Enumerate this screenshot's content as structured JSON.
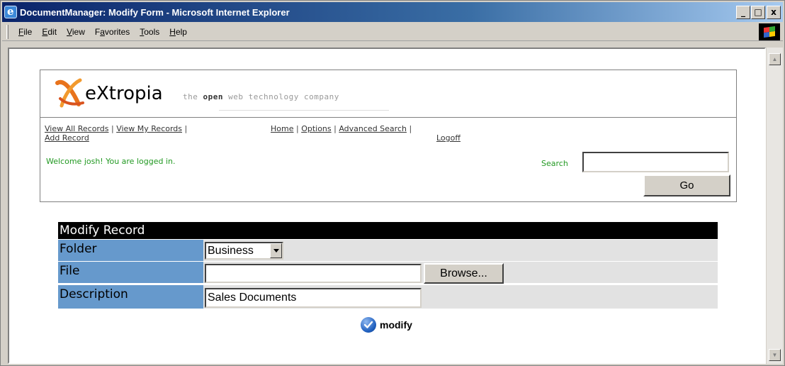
{
  "window": {
    "title": "DocumentManager: Modify Form - Microsoft Internet Explorer",
    "controls": [
      "_",
      "□",
      "x"
    ]
  },
  "menu": {
    "items": [
      {
        "label": "File",
        "underline_index": 0
      },
      {
        "label": "Edit",
        "underline_index": 0
      },
      {
        "label": "View",
        "underline_index": 0
      },
      {
        "label": "Favorites",
        "underline_index": 1
      },
      {
        "label": "Tools",
        "underline_index": 0
      },
      {
        "label": "Help",
        "underline_index": 0
      }
    ]
  },
  "logo": {
    "word": "eXtropia",
    "tag_prefix": "the ",
    "tag_bold": "open",
    "tag_suffix": " web technology company",
    "icon": "extropia-x-logo"
  },
  "nav": {
    "view_all": "View All Records",
    "view_my": "View My Records",
    "add_record": "Add Record",
    "home": "Home",
    "options": "Options",
    "advanced_search": "Advanced Search",
    "logoff": "Logoff",
    "separator": " | "
  },
  "welcome": "Welcome josh! You are logged in.",
  "search": {
    "label": "Search",
    "value": "",
    "button": "Go"
  },
  "form": {
    "title": "Modify Record",
    "folder_label": "Folder",
    "folder_value": "Business",
    "file_label": "File",
    "file_value": "",
    "browse_label": "Browse...",
    "description_label": "Description",
    "description_value": "Sales Documents",
    "submit_label": "modify",
    "submit_icon": "check-circle-icon"
  },
  "colors": {
    "label_bg": "#6699cc",
    "row_bg": "#e2e2e2",
    "welcome_text": "#229922",
    "header_bg": "#000000"
  }
}
